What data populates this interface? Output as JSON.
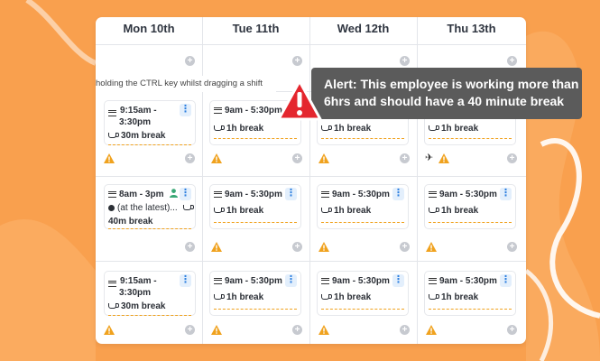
{
  "colors": {
    "background": "#f9a04e",
    "accent": "#f0a21e",
    "alert_bg": "#5b5b5b",
    "alert_sign": "#e4262e",
    "kebab": "#2d7fe0"
  },
  "columns": [
    "Mon 10th",
    "Tue 11th",
    "Wed 12th",
    "Thu 13th"
  ],
  "hint": "holding the CTRL key whilst dragging a shift",
  "alert": {
    "line1": "Alert: This employee is working more than",
    "line2": "6hrs and should have a 40 minute break"
  },
  "shifts": {
    "mon1": {
      "time1": "9:15am -",
      "time2": "3:30pm",
      "break": "30m break"
    },
    "tue1": {
      "time1": "9am - 5:30pm",
      "break": "1h break"
    },
    "wed1": {
      "break": "1h break"
    },
    "thu1": {
      "break": "1h break"
    },
    "mon2": {
      "time1": "8am - 3pm",
      "note": "(at the latest)...",
      "break": "40m break"
    },
    "tue2": {
      "time1": "9am - 5:30pm",
      "break": "1h break"
    },
    "wed2": {
      "time1": "9am - 5:30pm",
      "break": "1h break"
    },
    "thu2": {
      "time1": "9am - 5:30pm",
      "break": "1h break"
    },
    "mon3": {
      "time1": "9:15am -",
      "time2": "3:30pm",
      "break": "30m break"
    },
    "tue3": {
      "time1": "9am - 5:30pm",
      "break": "1h break"
    },
    "wed3": {
      "time1": "9am - 5:30pm",
      "break": "1h break"
    },
    "thu3": {
      "time1": "9am - 5:30pm",
      "break": "1h break"
    }
  },
  "icons": {
    "plus": "+",
    "kebab": "⋮",
    "plane": "✈",
    "warning": "warning-icon",
    "cup": "cup-icon",
    "menu": "menu-icon",
    "person": "person-icon"
  }
}
